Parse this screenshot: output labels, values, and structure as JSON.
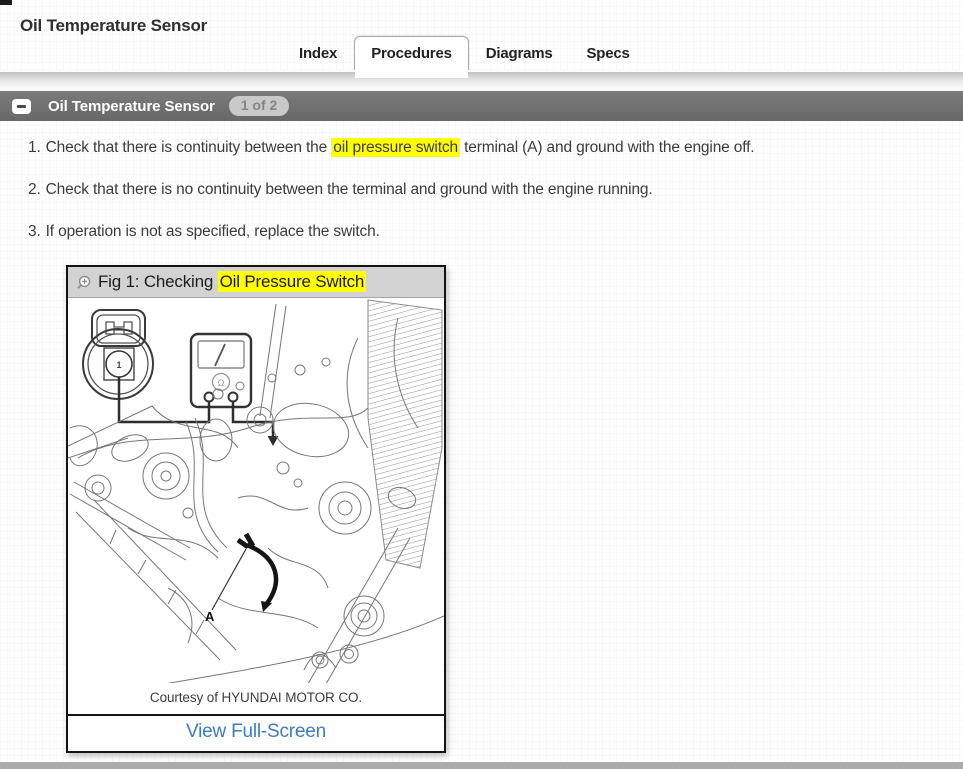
{
  "page": {
    "title": "Oil Temperature Sensor"
  },
  "tabs": {
    "items": [
      {
        "label": "Index",
        "active": false
      },
      {
        "label": "Procedures",
        "active": true
      },
      {
        "label": "Diagrams",
        "active": false
      },
      {
        "label": "Specs",
        "active": false
      }
    ]
  },
  "section_bar": {
    "collapse_icon": "minus-icon",
    "title": "Oil Temperature Sensor",
    "page_badge": "1 of 2"
  },
  "procedure": {
    "steps": [
      {
        "number": "1.",
        "pre": "Check that there is continuity between the ",
        "highlight": "oil pressure switch",
        "post": " terminal (A) and ground with the engine off."
      },
      {
        "number": "2.",
        "pre": "Check that there is no continuity between the terminal and ground with the engine running."
      },
      {
        "number": "3.",
        "pre": "If operation is not as specified, replace the switch."
      }
    ]
  },
  "figure": {
    "zoom_icon": "zoom-in-icon",
    "title_pre": "Fig 1: Checking ",
    "title_highlight": "Oil Pressure Switch",
    "connector_pin_label": "1",
    "meter_symbol": "Ω",
    "diagram_label": "A",
    "caption": "Courtesy of HYUNDAI MOTOR CO.",
    "fullscreen_link": "View Full-Screen"
  },
  "colors": {
    "highlight": "#ffff00",
    "link_blue": "#3e7cc2",
    "section_bar_gray": "#6f6f6f",
    "badge_gray": "#c9c9c9"
  }
}
